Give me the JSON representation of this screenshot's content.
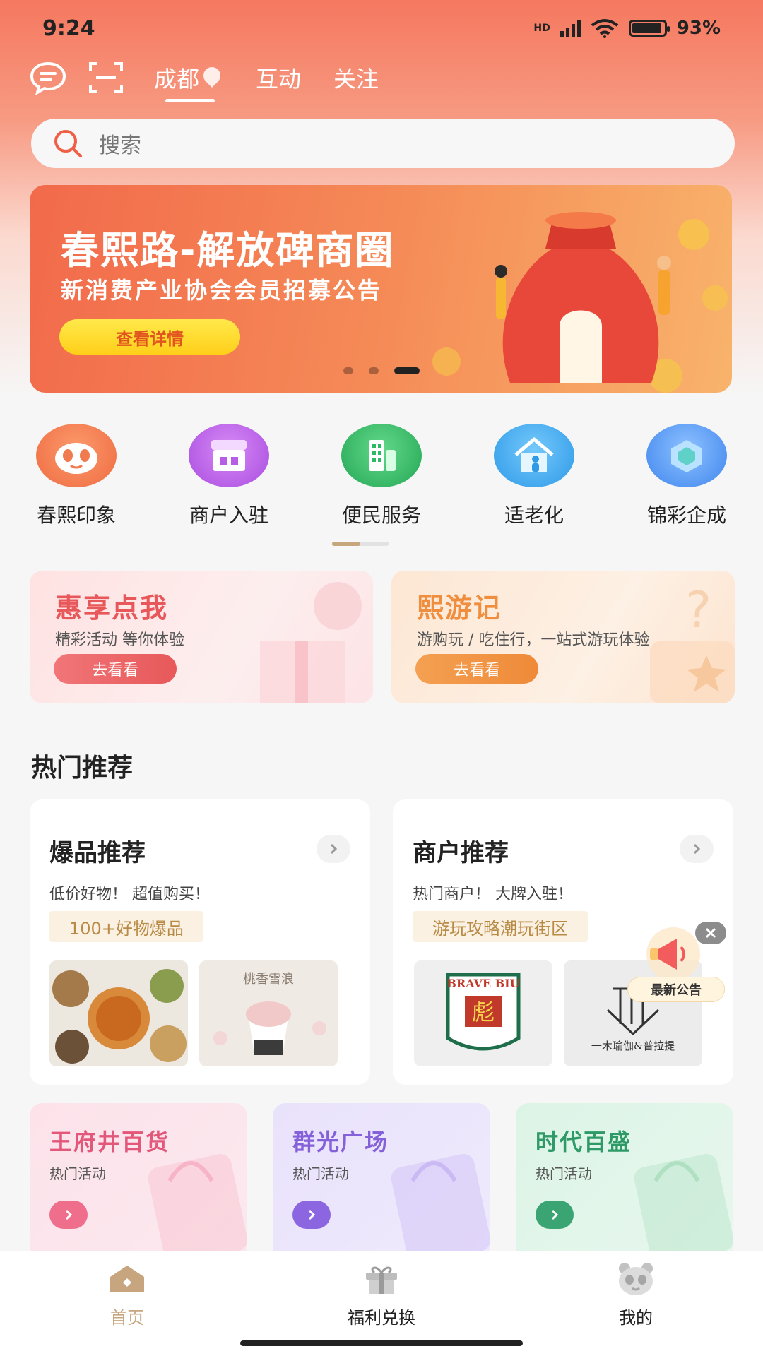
{
  "status_bar": {
    "time": "9:24",
    "network": "HD",
    "battery": "93%",
    "battery_level": 0.93
  },
  "top_nav": {
    "city": "成都",
    "tabs": [
      "互动",
      "关注"
    ]
  },
  "search": {
    "placeholder": "搜索"
  },
  "banner": {
    "title": "春熙路-解放碑商圈",
    "subtitle": "新消费产业协会会员招募公告",
    "button": "查看详情",
    "slides": 3,
    "active_slide": 3
  },
  "quick_entries": [
    {
      "label": "春熙印象",
      "icon": "panda-icon",
      "color": "#f47a50"
    },
    {
      "label": "商户入驻",
      "icon": "store-icon",
      "color": "#b75ee8"
    },
    {
      "label": "便民服务",
      "icon": "building-icon",
      "color": "#2fb864"
    },
    {
      "label": "适老化",
      "icon": "elder-home-icon",
      "color": "#3aa8ef"
    },
    {
      "label": "锦彩企成",
      "icon": "cube-icon",
      "color": "#4a8ef2"
    }
  ],
  "promos": [
    {
      "title": "惠享点我",
      "subtitle": "精彩活动 等你体验",
      "button": "去看看",
      "color": "#e8585a"
    },
    {
      "title": "熙游记",
      "subtitle": "游购玩 / 吃住行，一站式游玩体验",
      "button": "去看看",
      "color": "#ef8e3e"
    }
  ],
  "hot_section": {
    "title": "热门推荐"
  },
  "recommend": [
    {
      "title": "爆品推荐",
      "subtitle": "低价好物！ 超值购买！",
      "tag": "100+好物爆品",
      "images": [
        "food-platter",
        "桃香雪浪"
      ]
    },
    {
      "title": "商户推荐",
      "subtitle": "热门商户！ 大牌入驻！",
      "tag": "游玩攻略潮玩街区",
      "images": [
        "BRAVE BIU",
        "一木瑜伽&普拉提"
      ]
    }
  ],
  "notice": {
    "label": "最新公告"
  },
  "malls": [
    {
      "title": "王府井百货",
      "subtitle": "热门活动",
      "color": "#e2577a"
    },
    {
      "title": "群光广场",
      "subtitle": "热门活动",
      "color": "#8460d9"
    },
    {
      "title": "时代百盛",
      "subtitle": "热门活动",
      "color": "#2e9a67"
    }
  ],
  "bottom_nav": [
    {
      "label": "首页",
      "icon": "home-icon",
      "active": true
    },
    {
      "label": "福利兑换",
      "icon": "gift-icon",
      "active": false
    },
    {
      "label": "我的",
      "icon": "panda-face-icon",
      "active": false
    }
  ],
  "colors": {
    "accent": "#c7a57e",
    "header": "#f5785f"
  }
}
